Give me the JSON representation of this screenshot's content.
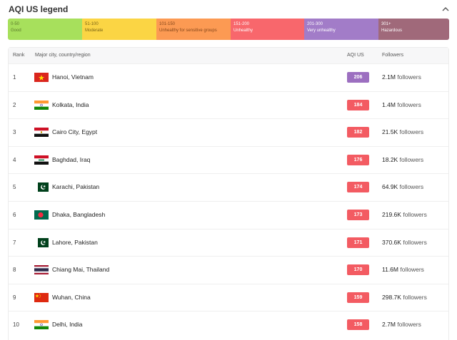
{
  "header": {
    "title": "AQI US legend",
    "collapse_icon": "chevron-up-icon"
  },
  "legend": [
    {
      "range": "0-50",
      "name": "Good",
      "color": "#a7e05c",
      "text": "#5a7a2a"
    },
    {
      "range": "51-100",
      "name": "Moderate",
      "color": "#fbd544",
      "text": "#7a6416"
    },
    {
      "range": "101-150",
      "name": "Unhealthy for sensitive groups",
      "color": "#fc9a53",
      "text": "#84461a"
    },
    {
      "range": "151-200",
      "name": "Unhealthy",
      "color": "#f8676c",
      "text": "#ffffff"
    },
    {
      "range": "201-300",
      "name": "Very unhealthy",
      "color": "#a27cc8",
      "text": "#ffffff"
    },
    {
      "range": "301+",
      "name": "Hazardous",
      "color": "#a0697a",
      "text": "#ffffff"
    }
  ],
  "table": {
    "headers": {
      "rank": "Rank",
      "city": "Major city, country/region",
      "aqi": "AQI US",
      "followers": "Followers"
    },
    "follower_suffix": "followers",
    "rows": [
      {
        "rank": "1",
        "flag": "vietnam",
        "city": "Hanoi, Vietnam",
        "aqi": "206",
        "aqi_color": "#9c6fc0",
        "followers": "2.1M"
      },
      {
        "rank": "2",
        "flag": "india",
        "city": "Kolkata, India",
        "aqi": "184",
        "aqi_color": "#f35b62",
        "followers": "1.4M"
      },
      {
        "rank": "3",
        "flag": "egypt",
        "city": "Cairo City, Egypt",
        "aqi": "182",
        "aqi_color": "#f35b62",
        "followers": "21.5K"
      },
      {
        "rank": "4",
        "flag": "iraq",
        "city": "Baghdad, Iraq",
        "aqi": "176",
        "aqi_color": "#f35b62",
        "followers": "18.2K"
      },
      {
        "rank": "5",
        "flag": "pakistan",
        "city": "Karachi, Pakistan",
        "aqi": "174",
        "aqi_color": "#f35b62",
        "followers": "64.9K"
      },
      {
        "rank": "6",
        "flag": "bangladesh",
        "city": "Dhaka, Bangladesh",
        "aqi": "173",
        "aqi_color": "#f35b62",
        "followers": "219.6K"
      },
      {
        "rank": "7",
        "flag": "pakistan",
        "city": "Lahore, Pakistan",
        "aqi": "171",
        "aqi_color": "#f35b62",
        "followers": "370.6K"
      },
      {
        "rank": "8",
        "flag": "thailand",
        "city": "Chiang Mai, Thailand",
        "aqi": "170",
        "aqi_color": "#f35b62",
        "followers": "11.6M"
      },
      {
        "rank": "9",
        "flag": "china",
        "city": "Wuhan, China",
        "aqi": "159",
        "aqi_color": "#f35b62",
        "followers": "298.7K"
      },
      {
        "rank": "10",
        "flag": "india",
        "city": "Delhi, India",
        "aqi": "158",
        "aqi_color": "#f35b62",
        "followers": "2.7M"
      }
    ]
  }
}
